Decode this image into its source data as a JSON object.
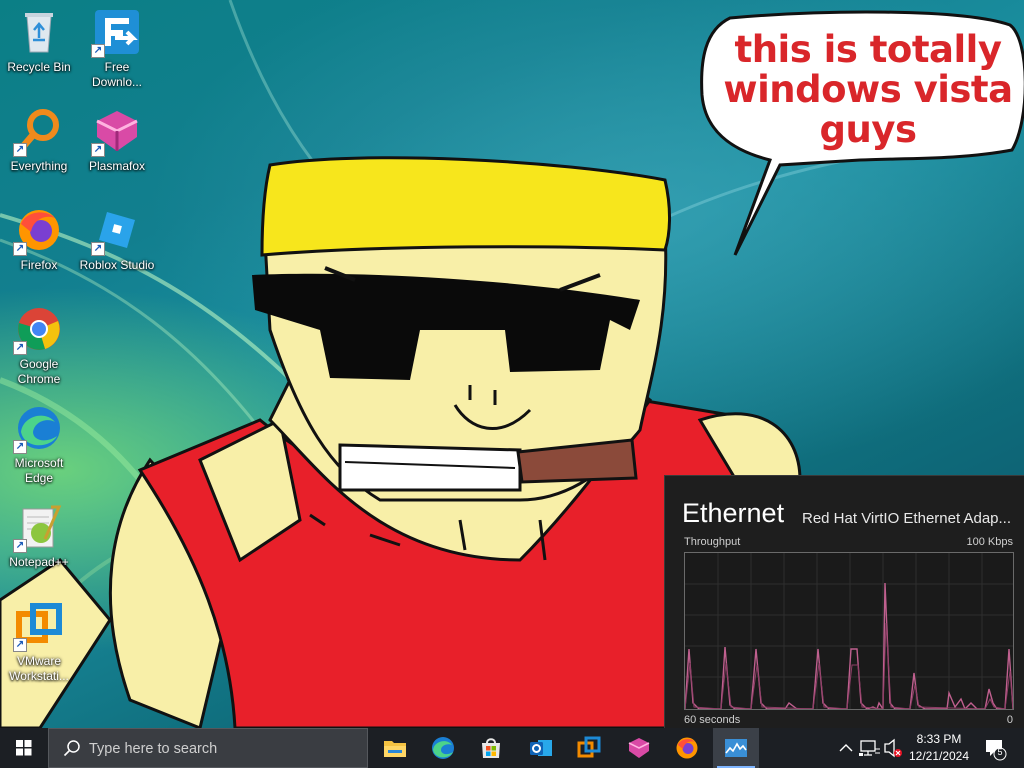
{
  "wallpaper": {
    "speech_bubble_text": "this is totally windows vista guys"
  },
  "desktop_icons": [
    {
      "label": "Recycle Bin",
      "icon": "recycle-bin-icon"
    },
    {
      "label": "Free Downlo...",
      "icon": "free-download-manager-icon"
    },
    {
      "label": "Everything",
      "icon": "everything-search-icon"
    },
    {
      "label": "Plasmafox",
      "icon": "plasmafox-icon"
    },
    {
      "label": "Firefox",
      "icon": "firefox-icon"
    },
    {
      "label": "Roblox Studio",
      "icon": "roblox-studio-icon"
    },
    {
      "label": "Google Chrome",
      "icon": "chrome-icon"
    },
    {
      "label": "Microsoft Edge",
      "icon": "edge-icon"
    },
    {
      "label": "Notepad++",
      "icon": "notepad-plus-plus-icon"
    },
    {
      "label": "VMware Workstati...",
      "icon": "vmware-workstation-icon"
    }
  ],
  "task_manager_panel": {
    "title": "Ethernet",
    "adapter": "Red Hat VirtIO Ethernet Adap...",
    "graph_label": "Throughput",
    "graph_max": "100 Kbps",
    "graph_time": "60 seconds",
    "graph_min": "0",
    "line_color": "#c0608f"
  },
  "taskbar": {
    "search_placeholder": "Type here to search",
    "pinned_apps": [
      {
        "name": "File Explorer",
        "icon": "file-explorer-icon"
      },
      {
        "name": "Microsoft Edge",
        "icon": "edge-icon"
      },
      {
        "name": "Microsoft Store",
        "icon": "store-icon"
      },
      {
        "name": "Outlook",
        "icon": "outlook-icon"
      },
      {
        "name": "VMware Workstation",
        "icon": "vmware-icon"
      },
      {
        "name": "Plasmafox",
        "icon": "plasmafox-icon"
      },
      {
        "name": "Firefox",
        "icon": "firefox-icon"
      },
      {
        "name": "Task Manager",
        "icon": "task-manager-icon",
        "active": true
      }
    ],
    "time": "8:33 PM",
    "date": "12/21/2024",
    "notification_count": "5"
  }
}
